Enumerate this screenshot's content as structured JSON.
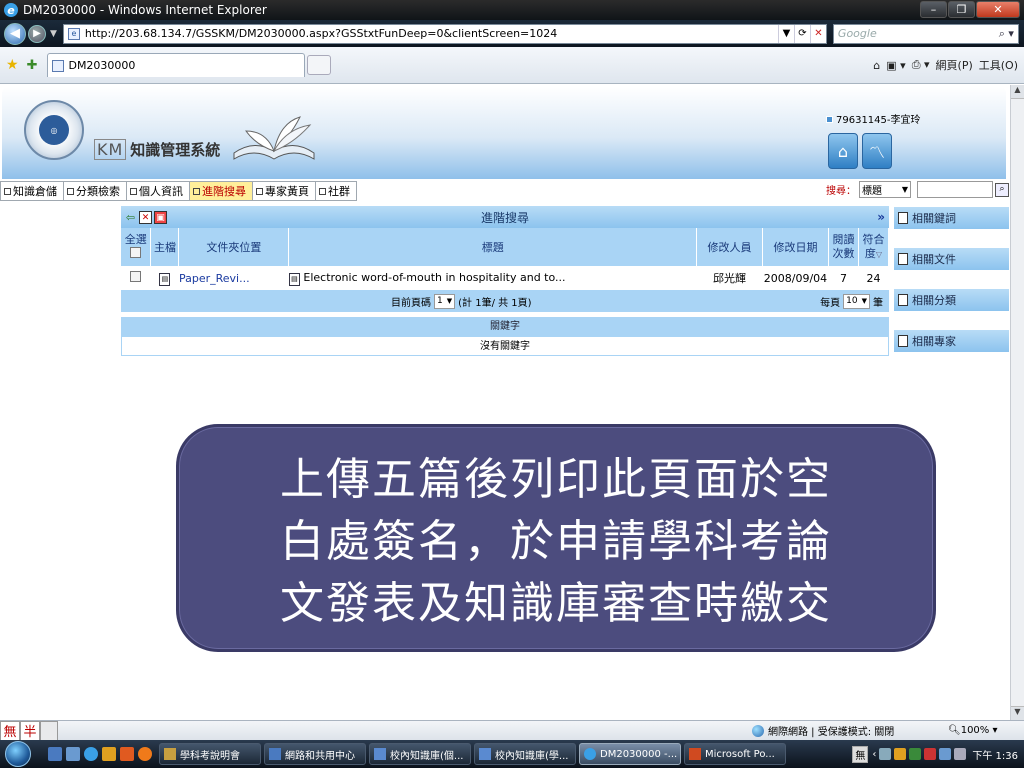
{
  "window": {
    "title": "DM2030000 - Windows Internet Explorer",
    "url": "http://203.68.134.7/GSSKM/DM2030000.aspx?GSStxtFunDeep=0&clientScreen=1024",
    "search_placeholder": "Google",
    "tab_title": "DM2030000",
    "cmd_home": "⌂",
    "cmd_page": "網頁(P)",
    "cmd_tools": "工具(O)"
  },
  "header": {
    "system_name": "知識管理系統",
    "km_mark": "KM",
    "user": "79631145-李宜玲"
  },
  "menu": {
    "items": [
      {
        "label": "知識倉儲"
      },
      {
        "label": "分類檢索"
      },
      {
        "label": "個人資訊"
      },
      {
        "label": "進階搜尋"
      },
      {
        "label": "專家黃頁"
      },
      {
        "label": "社群"
      }
    ],
    "search_label": "搜尋：",
    "search_type": "標題"
  },
  "panel": {
    "title": "進階搜尋",
    "columns": {
      "select_all": "全選",
      "main_file": "主檔",
      "folder": "文件夾位置",
      "title": "標題",
      "modifier": "修改人員",
      "modified_date": "修改日期",
      "read_count": "閱讀次數",
      "relevance": "符合度"
    },
    "rows": [
      {
        "folder": "Paper_Revi...",
        "title": "Electronic word-of-mouth in hospitality and to...",
        "modifier": "邱光輝",
        "modified_date": "2008/09/04",
        "read_count": "7",
        "relevance": "24"
      }
    ],
    "pager": {
      "current_label": "目前頁碼",
      "current_page": "1",
      "summary": "(計 1筆/ 共 1頁)",
      "per_page_label": "每頁",
      "per_page": "10",
      "per_page_unit": "筆"
    },
    "keyword_header": "關鍵字",
    "keyword_empty": "沒有關鍵字"
  },
  "sidebar": {
    "items": [
      {
        "label": "相關鍵詞"
      },
      {
        "label": "相關文件"
      },
      {
        "label": "相關分類"
      },
      {
        "label": "相關專家"
      }
    ]
  },
  "callout": {
    "lines": [
      "上傳五篇後列印此頁面於空",
      "白處簽名，於申請學科考論",
      "文發表及知識庫審查時繳交"
    ]
  },
  "statusbar": {
    "ime_1": "無",
    "ime_2": "半",
    "zone": "網際網路 | 受保護模式: 關閉",
    "zoom": "100%"
  },
  "taskbar": {
    "tasks": [
      {
        "label": "學科考說明會"
      },
      {
        "label": "網路和共用中心"
      },
      {
        "label": "校內知識庫(個..."
      },
      {
        "label": "校內知識庫(學..."
      },
      {
        "label": "DM2030000 -..."
      },
      {
        "label": "Microsoft Po..."
      }
    ],
    "clock": "下午 1:36",
    "tray_label": "無"
  }
}
